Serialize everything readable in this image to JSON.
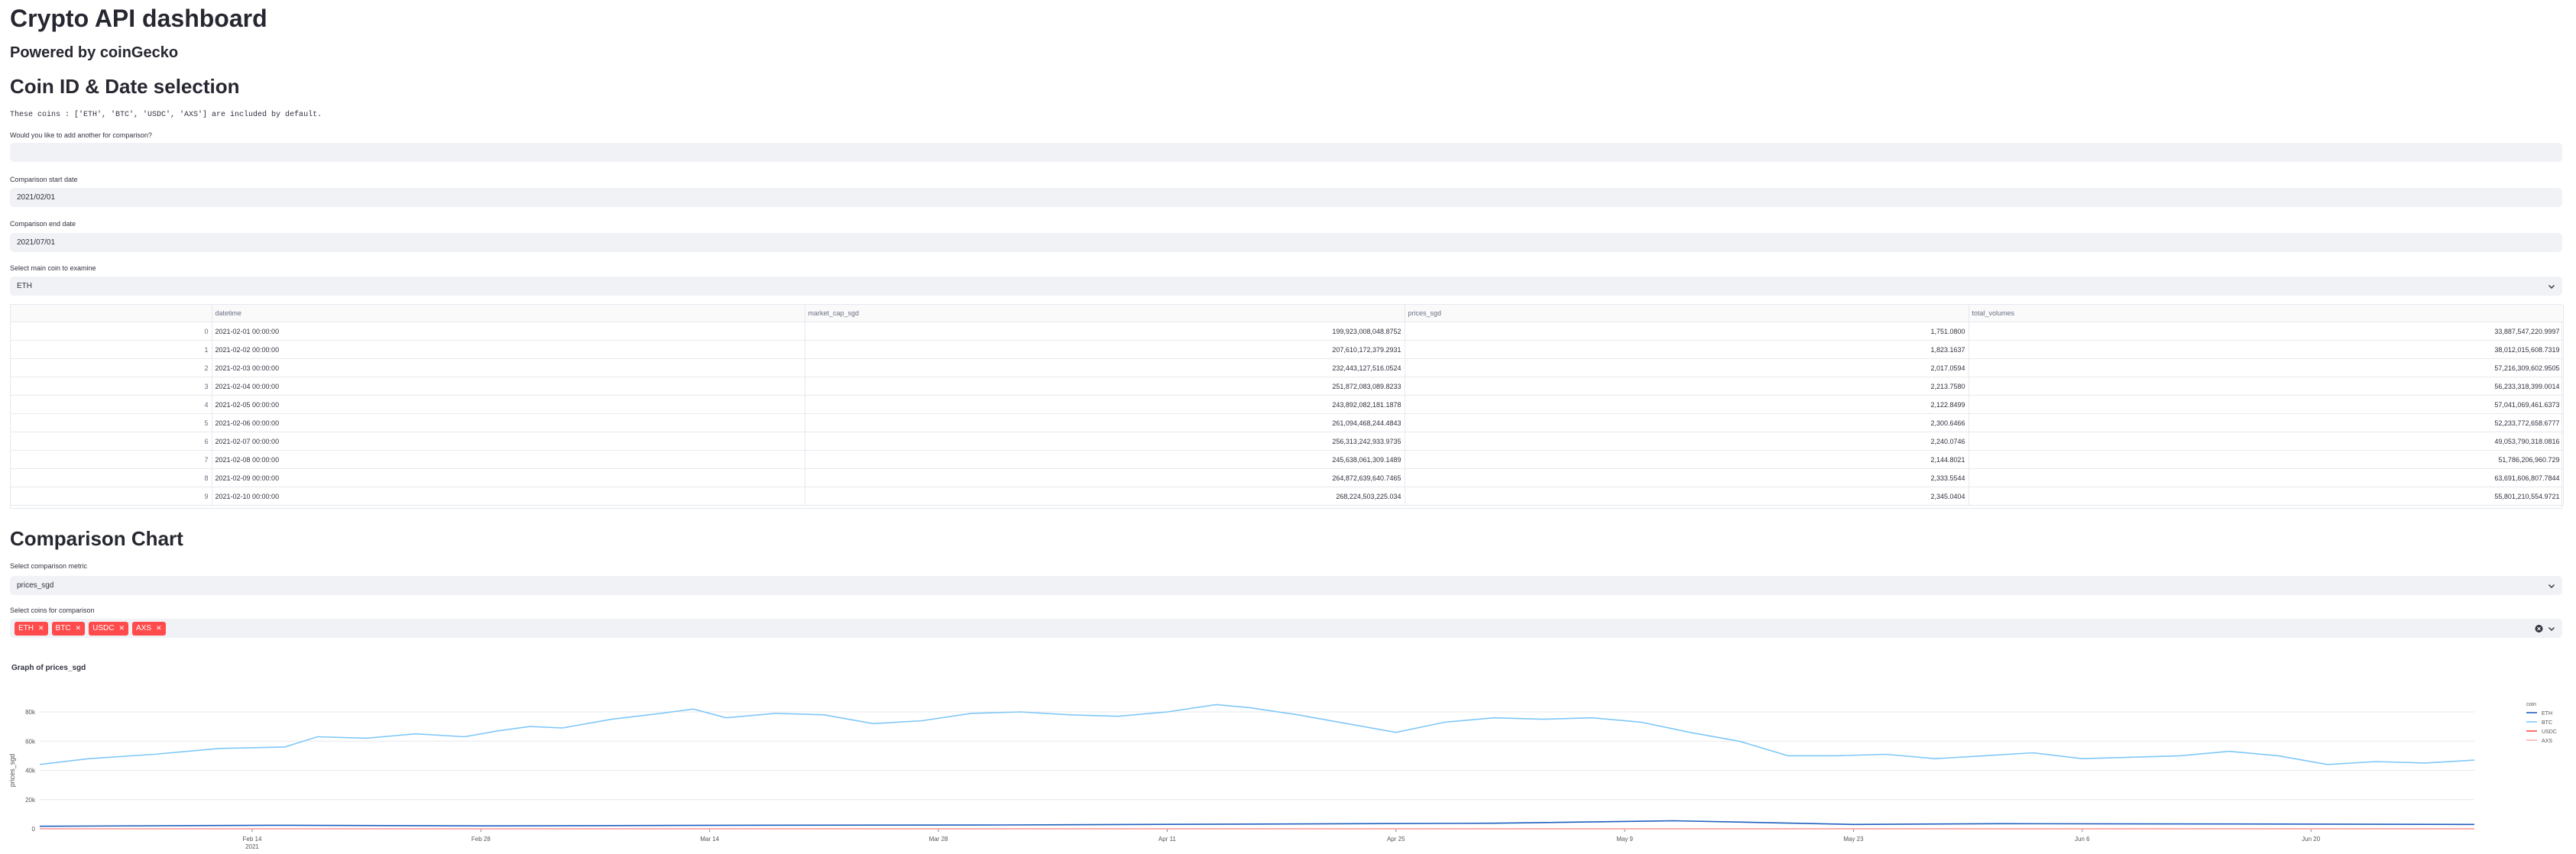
{
  "header": {
    "title": "Crypto API dashboard",
    "subtitle": "Powered by coinGecko"
  },
  "selection": {
    "heading": "Coin ID & Date selection",
    "default_coins_note": "These coins : ['ETH', 'BTC', 'USDC', 'AXS'] are included by default.",
    "add_coin_label": "Would you like to add another for comparison?",
    "add_coin_value": "",
    "start_date_label": "Comparison start date",
    "start_date_value": "2021/02/01",
    "end_date_label": "Comparison end date",
    "end_date_value": "2021/07/01",
    "main_coin_label": "Select main coin to examine",
    "main_coin_value": "ETH"
  },
  "table": {
    "columns": [
      "",
      "datetime",
      "market_cap_sgd",
      "prices_sgd",
      "total_volumes"
    ],
    "rows": [
      [
        "0",
        "2021-02-01 00:00:00",
        "199,923,008,048.8752",
        "1,751.0800",
        "33,887,547,220.9997"
      ],
      [
        "1",
        "2021-02-02 00:00:00",
        "207,610,172,379.2931",
        "1,823.1637",
        "38,012,015,608.7319"
      ],
      [
        "2",
        "2021-02-03 00:00:00",
        "232,443,127,516.0524",
        "2,017.0594",
        "57,216,309,602.9505"
      ],
      [
        "3",
        "2021-02-04 00:00:00",
        "251,872,083,089.8233",
        "2,213.7580",
        "56,233,318,399.0014"
      ],
      [
        "4",
        "2021-02-05 00:00:00",
        "243,892,082,181.1878",
        "2,122.8499",
        "57,041,069,461.6373"
      ],
      [
        "5",
        "2021-02-06 00:00:00",
        "261,094,468,244.4843",
        "2,300.6466",
        "52,233,772,658.6777"
      ],
      [
        "6",
        "2021-02-07 00:00:00",
        "256,313,242,933.9735",
        "2,240.0746",
        "49,053,790,318.0816"
      ],
      [
        "7",
        "2021-02-08 00:00:00",
        "245,638,061,309.1489",
        "2,144.8021",
        "51,786,206,960.729"
      ],
      [
        "8",
        "2021-02-09 00:00:00",
        "264,872,639,640.7465",
        "2,333.5544",
        "63,691,606,807.7844"
      ],
      [
        "9",
        "2021-02-10 00:00:00",
        "268,224,503,225.034",
        "2,345.0404",
        "55,801,210,554.9721"
      ]
    ]
  },
  "comparison": {
    "heading": "Comparison Chart",
    "metric_label": "Select comparison metric",
    "metric_value": "prices_sgd",
    "coins_label": "Select coins for comparison",
    "tags": [
      "ETH",
      "BTC",
      "USDC",
      "AXS"
    ]
  },
  "chart_data": {
    "type": "line",
    "title": "Graph of prices_sgd",
    "ylabel": "prices_sgd",
    "xlabel": "",
    "legend_title": "coin",
    "legend_position": "right",
    "grid": true,
    "ylim": [
      0,
      80000
    ],
    "yticks": [
      0,
      20000,
      40000,
      60000,
      80000
    ],
    "ytick_labels": [
      "0",
      "20k",
      "40k",
      "60k",
      "80k"
    ],
    "x_start": "2021-02-01",
    "x_end": "2021-06-30",
    "xticks": [
      "2021-02-14",
      "2021-02-28",
      "2021-03-14",
      "2021-03-28",
      "2021-04-11",
      "2021-04-25",
      "2021-05-09",
      "2021-05-23",
      "2021-06-06",
      "2021-06-20"
    ],
    "xtick_labels": [
      "Feb 14",
      "Feb 28",
      "Mar 14",
      "Mar 28",
      "Apr 11",
      "Apr 25",
      "May 9",
      "May 23",
      "Jun 6",
      "Jun 20"
    ],
    "xtick_sub": [
      "2021",
      "",
      "",
      "",
      "",
      "",
      "",
      "",
      "",
      ""
    ],
    "series": [
      {
        "name": "ETH",
        "color": "#1f5fbf",
        "points": [
          [
            "2021-02-01",
            1751
          ],
          [
            "2021-02-15",
            2400
          ],
          [
            "2021-03-01",
            2000
          ],
          [
            "2021-03-15",
            2400
          ],
          [
            "2021-04-01",
            2600
          ],
          [
            "2021-04-15",
            3200
          ],
          [
            "2021-05-01",
            3800
          ],
          [
            "2021-05-12",
            5500
          ],
          [
            "2021-05-23",
            3000
          ],
          [
            "2021-06-01",
            3500
          ],
          [
            "2021-06-15",
            3300
          ],
          [
            "2021-06-30",
            3000
          ]
        ]
      },
      {
        "name": "BTC",
        "color": "#7fc8f8",
        "points": [
          [
            "2021-02-01",
            44000
          ],
          [
            "2021-02-04",
            48000
          ],
          [
            "2021-02-08",
            51000
          ],
          [
            "2021-02-12",
            55000
          ],
          [
            "2021-02-16",
            56000
          ],
          [
            "2021-02-18",
            63000
          ],
          [
            "2021-02-21",
            62000
          ],
          [
            "2021-02-24",
            65000
          ],
          [
            "2021-02-27",
            63000
          ],
          [
            "2021-03-01",
            67000
          ],
          [
            "2021-03-03",
            70000
          ],
          [
            "2021-03-05",
            69000
          ],
          [
            "2021-03-08",
            75000
          ],
          [
            "2021-03-11",
            79000
          ],
          [
            "2021-03-13",
            82000
          ],
          [
            "2021-03-15",
            76000
          ],
          [
            "2021-03-18",
            79000
          ],
          [
            "2021-03-21",
            78000
          ],
          [
            "2021-03-24",
            72000
          ],
          [
            "2021-03-27",
            74000
          ],
          [
            "2021-03-30",
            79000
          ],
          [
            "2021-04-02",
            80000
          ],
          [
            "2021-04-05",
            78000
          ],
          [
            "2021-04-08",
            77000
          ],
          [
            "2021-04-11",
            80000
          ],
          [
            "2021-04-14",
            85000
          ],
          [
            "2021-04-16",
            83000
          ],
          [
            "2021-04-19",
            78000
          ],
          [
            "2021-04-22",
            72000
          ],
          [
            "2021-04-25",
            66000
          ],
          [
            "2021-04-28",
            73000
          ],
          [
            "2021-05-01",
            76000
          ],
          [
            "2021-05-04",
            75000
          ],
          [
            "2021-05-07",
            76000
          ],
          [
            "2021-05-10",
            73000
          ],
          [
            "2021-05-13",
            66000
          ],
          [
            "2021-05-16",
            60000
          ],
          [
            "2021-05-19",
            50000
          ],
          [
            "2021-05-22",
            50000
          ],
          [
            "2021-05-25",
            51000
          ],
          [
            "2021-05-28",
            48000
          ],
          [
            "2021-05-31",
            50000
          ],
          [
            "2021-06-03",
            52000
          ],
          [
            "2021-06-06",
            48000
          ],
          [
            "2021-06-09",
            49000
          ],
          [
            "2021-06-12",
            50000
          ],
          [
            "2021-06-15",
            53000
          ],
          [
            "2021-06-18",
            50000
          ],
          [
            "2021-06-21",
            44000
          ],
          [
            "2021-06-24",
            46000
          ],
          [
            "2021-06-27",
            45000
          ],
          [
            "2021-06-30",
            47000
          ]
        ]
      },
      {
        "name": "USDC",
        "color": "#ff4b4b",
        "points": [
          [
            "2021-02-01",
            1.33
          ],
          [
            "2021-06-30",
            1.34
          ]
        ]
      },
      {
        "name": "AXS",
        "color": "#ffb3b3",
        "points": [
          [
            "2021-02-01",
            2
          ],
          [
            "2021-04-01",
            6
          ],
          [
            "2021-05-01",
            10
          ],
          [
            "2021-06-01",
            8
          ],
          [
            "2021-06-30",
            20
          ]
        ]
      }
    ]
  },
  "icons": {
    "select_chevron": "chevron-down-icon",
    "clear_all": "clear-icon",
    "tag_remove": "close-icon"
  },
  "colors": {
    "accent": "#ff4b4b",
    "input_bg": "#f0f2f6"
  }
}
